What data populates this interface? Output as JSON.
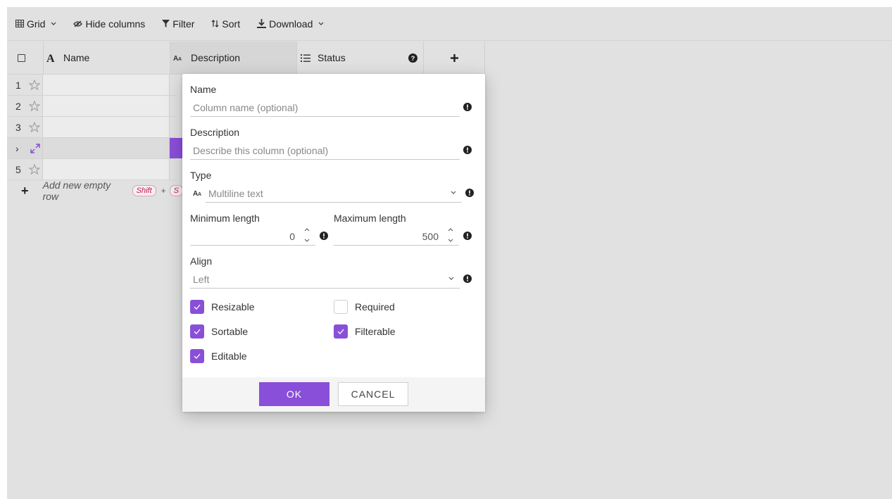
{
  "toolbar": {
    "grid_label": "Grid",
    "hide_columns_label": "Hide columns",
    "filter_label": "Filter",
    "sort_label": "Sort",
    "download_label": "Download"
  },
  "columns": [
    {
      "label": "Name",
      "icon": "text-type-icon"
    },
    {
      "label": "Description",
      "icon": "multiline-text-icon"
    },
    {
      "label": "Status",
      "icon": "list-icon"
    }
  ],
  "rows": [
    {
      "num": "1"
    },
    {
      "num": "2"
    },
    {
      "num": "3"
    },
    {
      "num": "›"
    },
    {
      "num": "5"
    }
  ],
  "add_row": {
    "label": "Add new empty row",
    "key1": "Shift",
    "plus": "+",
    "key2": "S"
  },
  "dialog": {
    "name_label": "Name",
    "name_placeholder": "Column name (optional)",
    "description_label": "Description",
    "description_placeholder": "Describe this column (optional)",
    "type_label": "Type",
    "type_value": "Multiline text",
    "min_label": "Minimum length",
    "min_value": "0",
    "max_label": "Maximum length",
    "max_value": "500",
    "align_label": "Align",
    "align_value": "Left",
    "checkboxes": [
      {
        "label": "Resizable",
        "checked": true
      },
      {
        "label": "Required",
        "checked": false
      },
      {
        "label": "Sortable",
        "checked": true
      },
      {
        "label": "Filterable",
        "checked": true
      },
      {
        "label": "Editable",
        "checked": true
      }
    ],
    "ok_label": "OK",
    "cancel_label": "CANCEL"
  },
  "colors": {
    "accent": "#8a4fd8",
    "background": "#e1e1e1"
  }
}
